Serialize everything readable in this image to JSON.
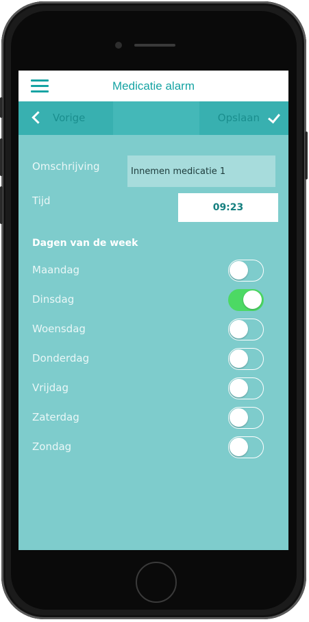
{
  "header": {
    "title": "Medicatie alarm",
    "menu_icon": "hamburger-menu-icon"
  },
  "toolbar": {
    "back_label": "Vorige",
    "save_label": "Opslaan",
    "back_icon": "chevron-left-icon",
    "save_icon": "checkmark-icon"
  },
  "form": {
    "description_label": "Omschrijving",
    "description_value": "Innemen medicatie 1",
    "time_label": "Tijd",
    "time_value": "09:23"
  },
  "days": {
    "heading": "Dagen van de week",
    "items": [
      {
        "label": "Maandag",
        "on": false
      },
      {
        "label": "Dinsdag",
        "on": true
      },
      {
        "label": "Woensdag",
        "on": false
      },
      {
        "label": "Donderdag",
        "on": false
      },
      {
        "label": "Vrijdag",
        "on": false
      },
      {
        "label": "Zaterdag",
        "on": false
      },
      {
        "label": "Zondag",
        "on": false
      }
    ]
  },
  "colors": {
    "accent": "#15a3a3",
    "background": "#7ecccc",
    "toolbar": "#3fb5b5",
    "toggle_on": "#4cd964"
  }
}
